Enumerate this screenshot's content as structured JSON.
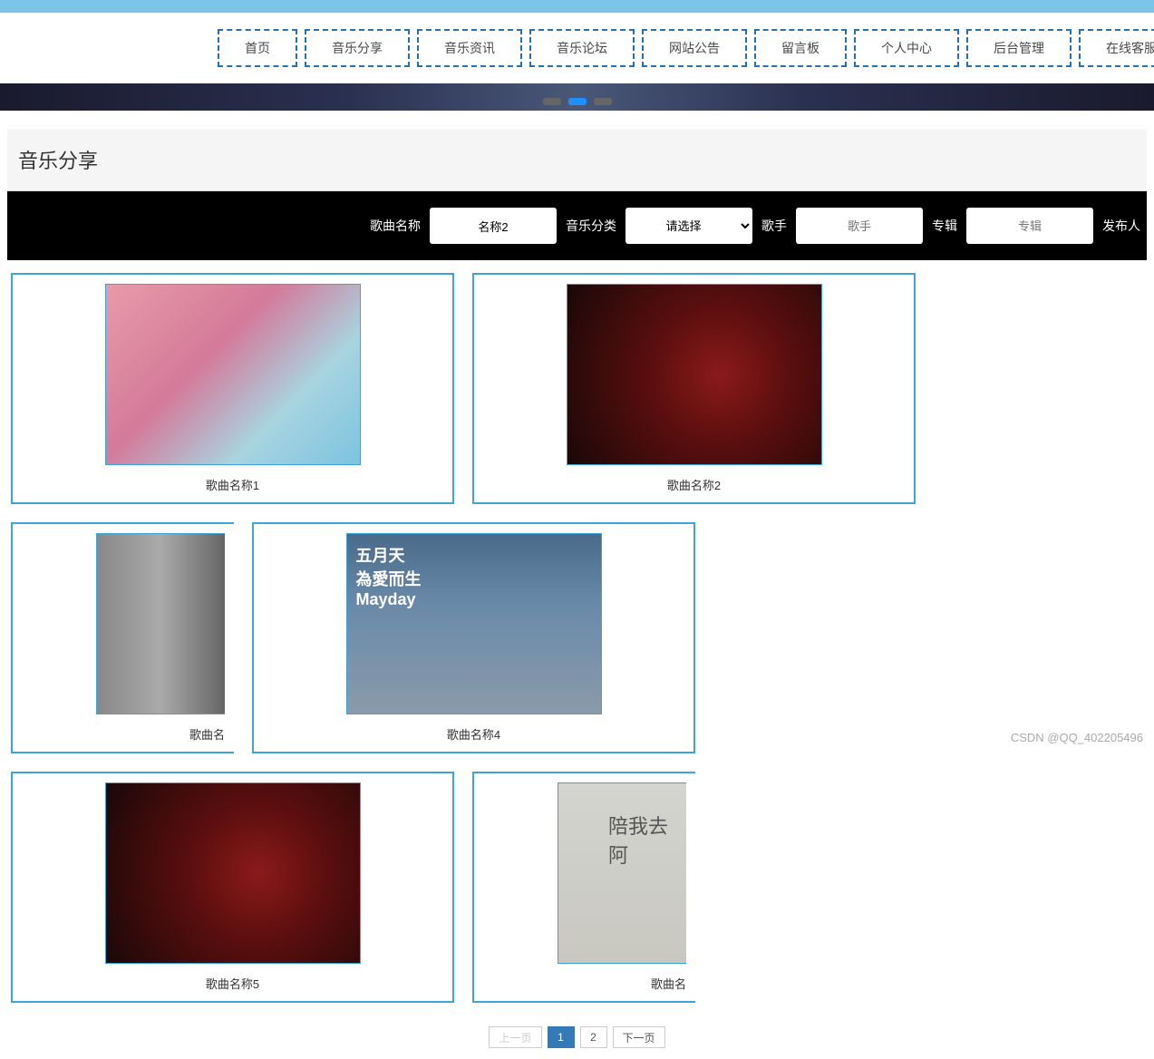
{
  "nav": {
    "items": [
      {
        "label": "首页"
      },
      {
        "label": "音乐分享"
      },
      {
        "label": "音乐资讯"
      },
      {
        "label": "音乐论坛"
      },
      {
        "label": "网站公告"
      },
      {
        "label": "留言板"
      },
      {
        "label": "个人中心"
      },
      {
        "label": "后台管理"
      },
      {
        "label": "在线客服"
      }
    ]
  },
  "section": {
    "title": "音乐分享"
  },
  "filter": {
    "song_name_label": "歌曲名称",
    "song_name_value": "名称2",
    "category_label": "音乐分类",
    "category_placeholder": "请选择",
    "singer_label": "歌手",
    "singer_placeholder": "歌手",
    "album_label": "专辑",
    "album_placeholder": "专辑",
    "publisher_label": "发布人"
  },
  "cards": [
    {
      "title": "歌曲名称1"
    },
    {
      "title": "歌曲名称2"
    },
    {
      "title": "歌曲名"
    },
    {
      "title": "歌曲名称4"
    },
    {
      "title": "歌曲名称5"
    },
    {
      "title": "歌曲名"
    }
  ],
  "pagination": {
    "prev": "上一页",
    "p1": "1",
    "p2": "2",
    "next": "下一页"
  },
  "watermark": "CSDN @QQ_402205496"
}
